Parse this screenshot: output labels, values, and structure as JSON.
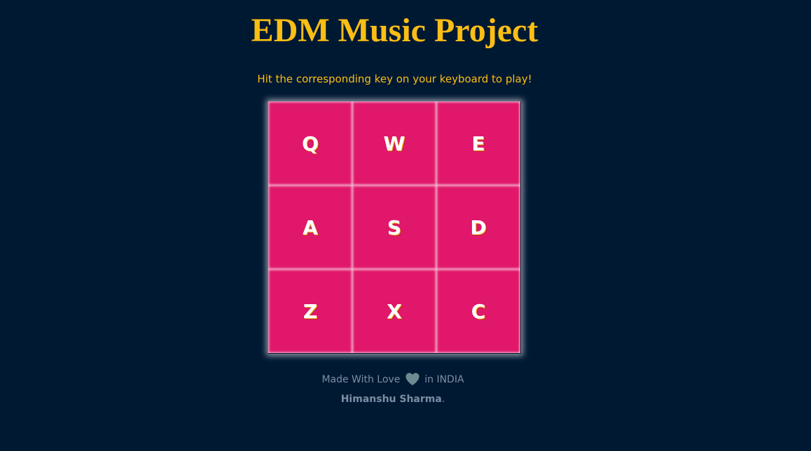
{
  "header": {
    "title": "EDM Music Project",
    "subtitle": "Hit the corresponding key on your keyboard to play!"
  },
  "pads": [
    {
      "key": "Q"
    },
    {
      "key": "W"
    },
    {
      "key": "E"
    },
    {
      "key": "A"
    },
    {
      "key": "S"
    },
    {
      "key": "D"
    },
    {
      "key": "Z"
    },
    {
      "key": "X"
    },
    {
      "key": "C"
    }
  ],
  "footer": {
    "made_with": "Made With Love",
    "heart_icon": "heart-icon",
    "location": "in INDIA",
    "author": "Himanshu Sharma",
    "period": "."
  },
  "colors": {
    "background": "#001933",
    "accent": "#fbbe14",
    "pad": "#e0176a",
    "footer_text": "#7c8ea3",
    "heart": "#6f8a91"
  }
}
